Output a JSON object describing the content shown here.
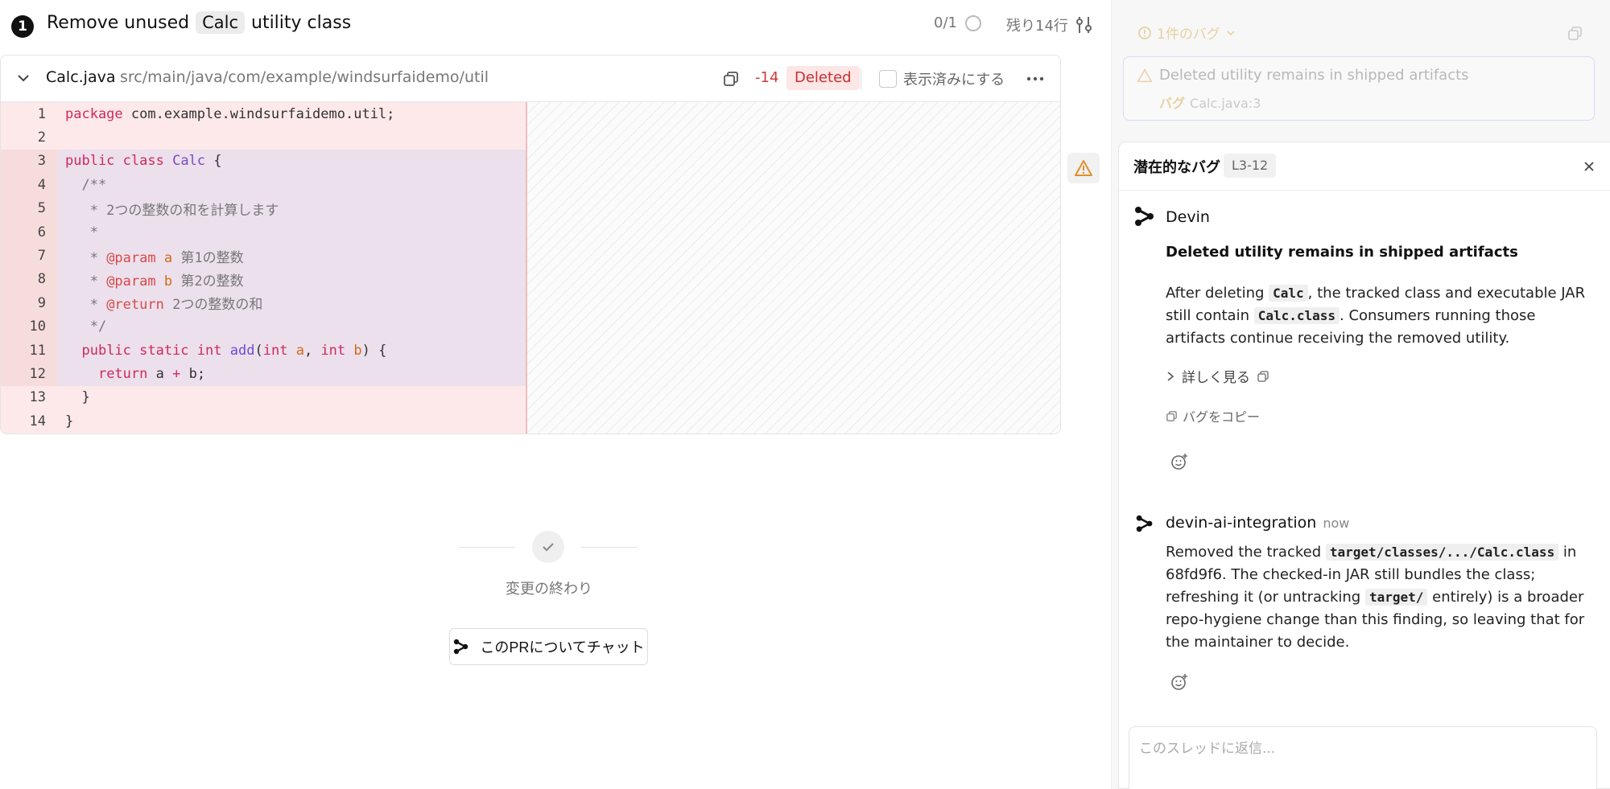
{
  "commit": {
    "step": "1",
    "title_before": "Remove unused",
    "title_code": "Calc",
    "title_after": "utility class",
    "progress": "0/1",
    "remaining": "残り14行"
  },
  "file": {
    "name": "Calc.java",
    "path": "src/main/java/com/example/windsurfaidemo/util",
    "removed_count": "-14",
    "status": "Deleted",
    "viewed_label": "表示済みにする"
  },
  "code_lines": [
    {
      "n": "1",
      "html": "<span class=\"kw\">package</span> com.example.windsurfaidemo.util;"
    },
    {
      "n": "2",
      "html": ""
    },
    {
      "n": "3",
      "html": "<span class=\"kw\">public class</span> <span class=\"ty\">Calc</span> {"
    },
    {
      "n": "4",
      "html": "  <span class=\"cm\">/**</span>"
    },
    {
      "n": "5",
      "html": "<span class=\"cm\">   * 2つの整数の和を計算します</span>"
    },
    {
      "n": "6",
      "html": "<span class=\"cm\">   *</span>"
    },
    {
      "n": "7",
      "html": "<span class=\"cm\">   * </span><span class=\"tag\">@param</span> <span class=\"kw2\">a</span><span class=\"cm\"> 第1の整数</span>"
    },
    {
      "n": "8",
      "html": "<span class=\"cm\">   * </span><span class=\"tag\">@param</span> <span class=\"kw2\">b</span><span class=\"cm\"> 第2の整数</span>"
    },
    {
      "n": "9",
      "html": "<span class=\"cm\">   * </span><span class=\"tag\">@return</span><span class=\"cm\"> 2つの整数の和</span>"
    },
    {
      "n": "10",
      "html": "<span class=\"cm\">   */</span>"
    },
    {
      "n": "11",
      "html": "  <span class=\"kw\">public static</span> <span class=\"kw\">int</span> <span class=\"fn\">add</span>(<span class=\"kw\">int</span> <span class=\"kw2\">a</span>, <span class=\"kw\">int</span> <span class=\"kw2\">b</span>) {"
    },
    {
      "n": "12",
      "html": "    <span class=\"kw\">return</span> a <span class=\"kw\">+</span> b;"
    },
    {
      "n": "13",
      "html": "  }"
    },
    {
      "n": "14",
      "html": "}"
    }
  ],
  "end": {
    "label": "変更の終わり",
    "chat_button": "このPRについてチャット"
  },
  "sidebar": {
    "bug_count": "1件のバグ",
    "faded_card_title": "Deleted utility remains in shipped artifacts",
    "faded_card_tag": "バグ",
    "faded_card_loc": "Calc.java:3"
  },
  "thread": {
    "title": "潜在的なバグ",
    "range": "L3-12",
    "author": "Devin",
    "finding_title": "Deleted utility remains in shipped artifacts",
    "body_1": "After deleting ",
    "body_code_1": "Calc",
    "body_2": ", the tracked class and executable JAR still contain ",
    "body_code_2": "Calc.class",
    "body_3": ". Consumers running those artifacts continue receiving the removed utility.",
    "details": "詳しく見る",
    "copy_bug": "バグをコピー",
    "reply_author": "devin-ai-integration",
    "reply_time": "now",
    "reply_1": "Removed the tracked ",
    "reply_code_1": "target/classes/.../Calc.class",
    "reply_2": " in 68fd9f6. The checked-in JAR still bundles the class; refreshing it (or untracking ",
    "reply_code_2": "target/",
    "reply_3": " entirely) is a broader repo-hygiene change than this finding, so leaving that for the maintainer to decide.",
    "reply_placeholder": "このスレッドに返信..."
  }
}
